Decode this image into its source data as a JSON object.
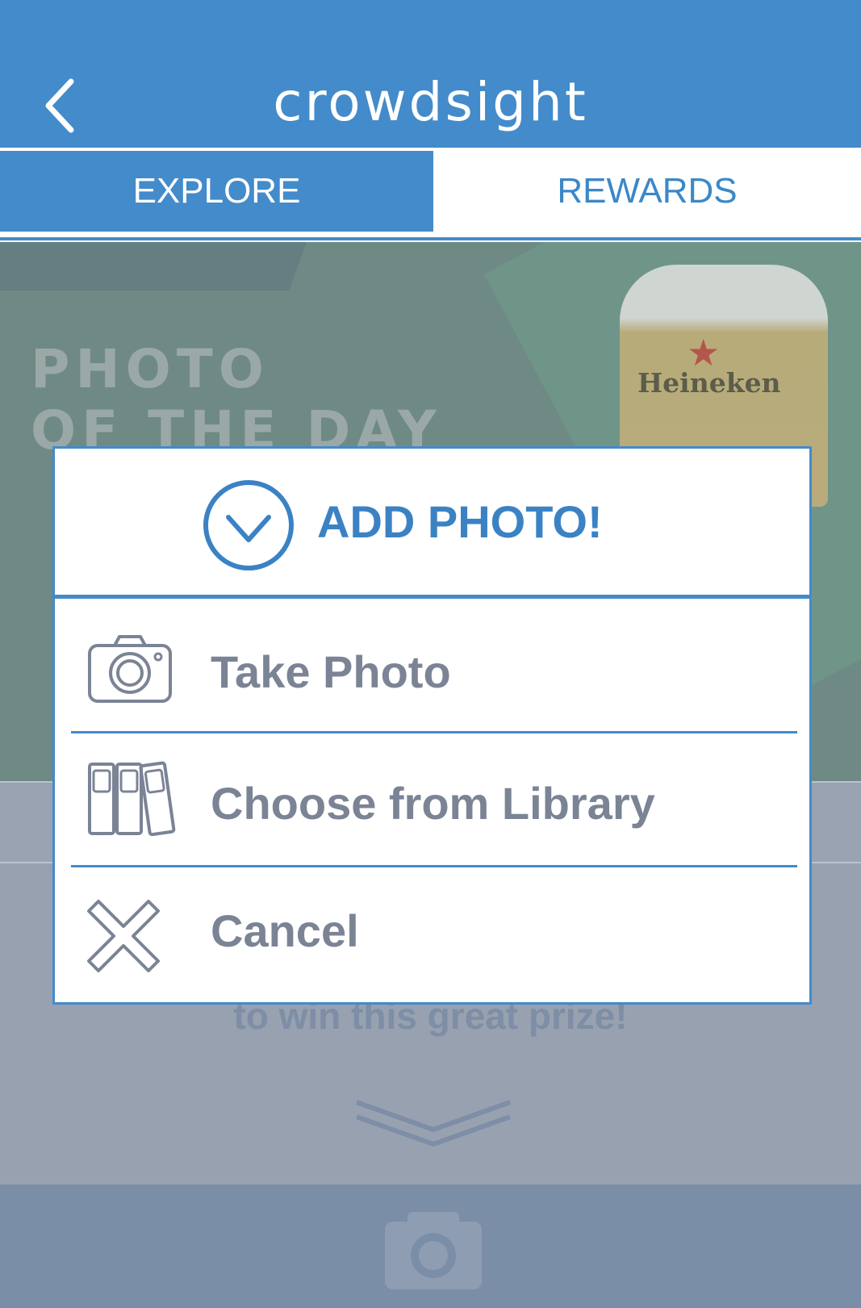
{
  "header": {
    "title": "crowdsight"
  },
  "tabs": [
    {
      "label": "EXPLORE",
      "active": true
    },
    {
      "label": "REWARDS",
      "active": false
    }
  ],
  "banner": {
    "title_line1": "PHOTO",
    "title_line2": "OF THE DAY",
    "beer_brand": "Heineken"
  },
  "background": {
    "prize_text": "to win this great prize!"
  },
  "modal": {
    "title": "ADD PHOTO!",
    "options": [
      {
        "label": "Take Photo",
        "icon": "camera-icon"
      },
      {
        "label": "Choose from Library",
        "icon": "library-icon"
      },
      {
        "label": "Cancel",
        "icon": "close-icon"
      }
    ]
  },
  "colors": {
    "primary": "#438bcb",
    "text_gray": "#7b8495",
    "overlay": "#98a1b0"
  }
}
